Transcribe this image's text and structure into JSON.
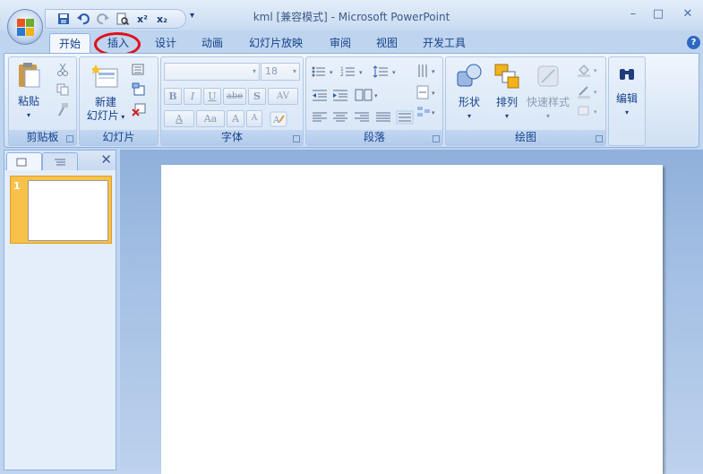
{
  "window": {
    "title": "kml [兼容模式] - Microsoft PowerPoint",
    "minimize": "–",
    "maximize": "□",
    "close": "✕"
  },
  "qat": {
    "items": [
      "save-icon",
      "undo-icon",
      "redo-icon",
      "print-preview-icon",
      "superscript-icon",
      "subscript-icon"
    ],
    "superscript_label": "x²",
    "subscript_label": "x₂",
    "more": "▾"
  },
  "tabs": [
    "开始",
    "插入",
    "设计",
    "动画",
    "幻灯片放映",
    "审阅",
    "视图",
    "开发工具"
  ],
  "active_tab": "开始",
  "annotation": {
    "color": "#e0101a"
  },
  "ribbon": {
    "clipboard": {
      "label": "剪贴板",
      "paste": "粘贴"
    },
    "slides": {
      "label": "幻灯片",
      "new_slide_line1": "新建",
      "new_slide_line2": "幻灯片"
    },
    "font": {
      "label": "字体",
      "font_name": "",
      "font_size": "18",
      "bold": "B",
      "italic": "I",
      "underline": "U",
      "strike": "abe",
      "shadow": "S",
      "spacing": "AV",
      "color": "A",
      "case": "Aa",
      "grow": "A",
      "shrink": "A"
    },
    "paragraph": {
      "label": "段落"
    },
    "drawing": {
      "label": "绘图",
      "shapes": "形状",
      "arrange": "排列",
      "quick_styles": "快速样式"
    },
    "editing": {
      "label": "编辑"
    }
  },
  "side_panel": {
    "slide_number": "1",
    "close": "✕"
  },
  "colors": {
    "ribbon_bg": "#dbe7f6",
    "thumb_selected": "#f7c14a",
    "workarea": "#a5c0e4"
  }
}
